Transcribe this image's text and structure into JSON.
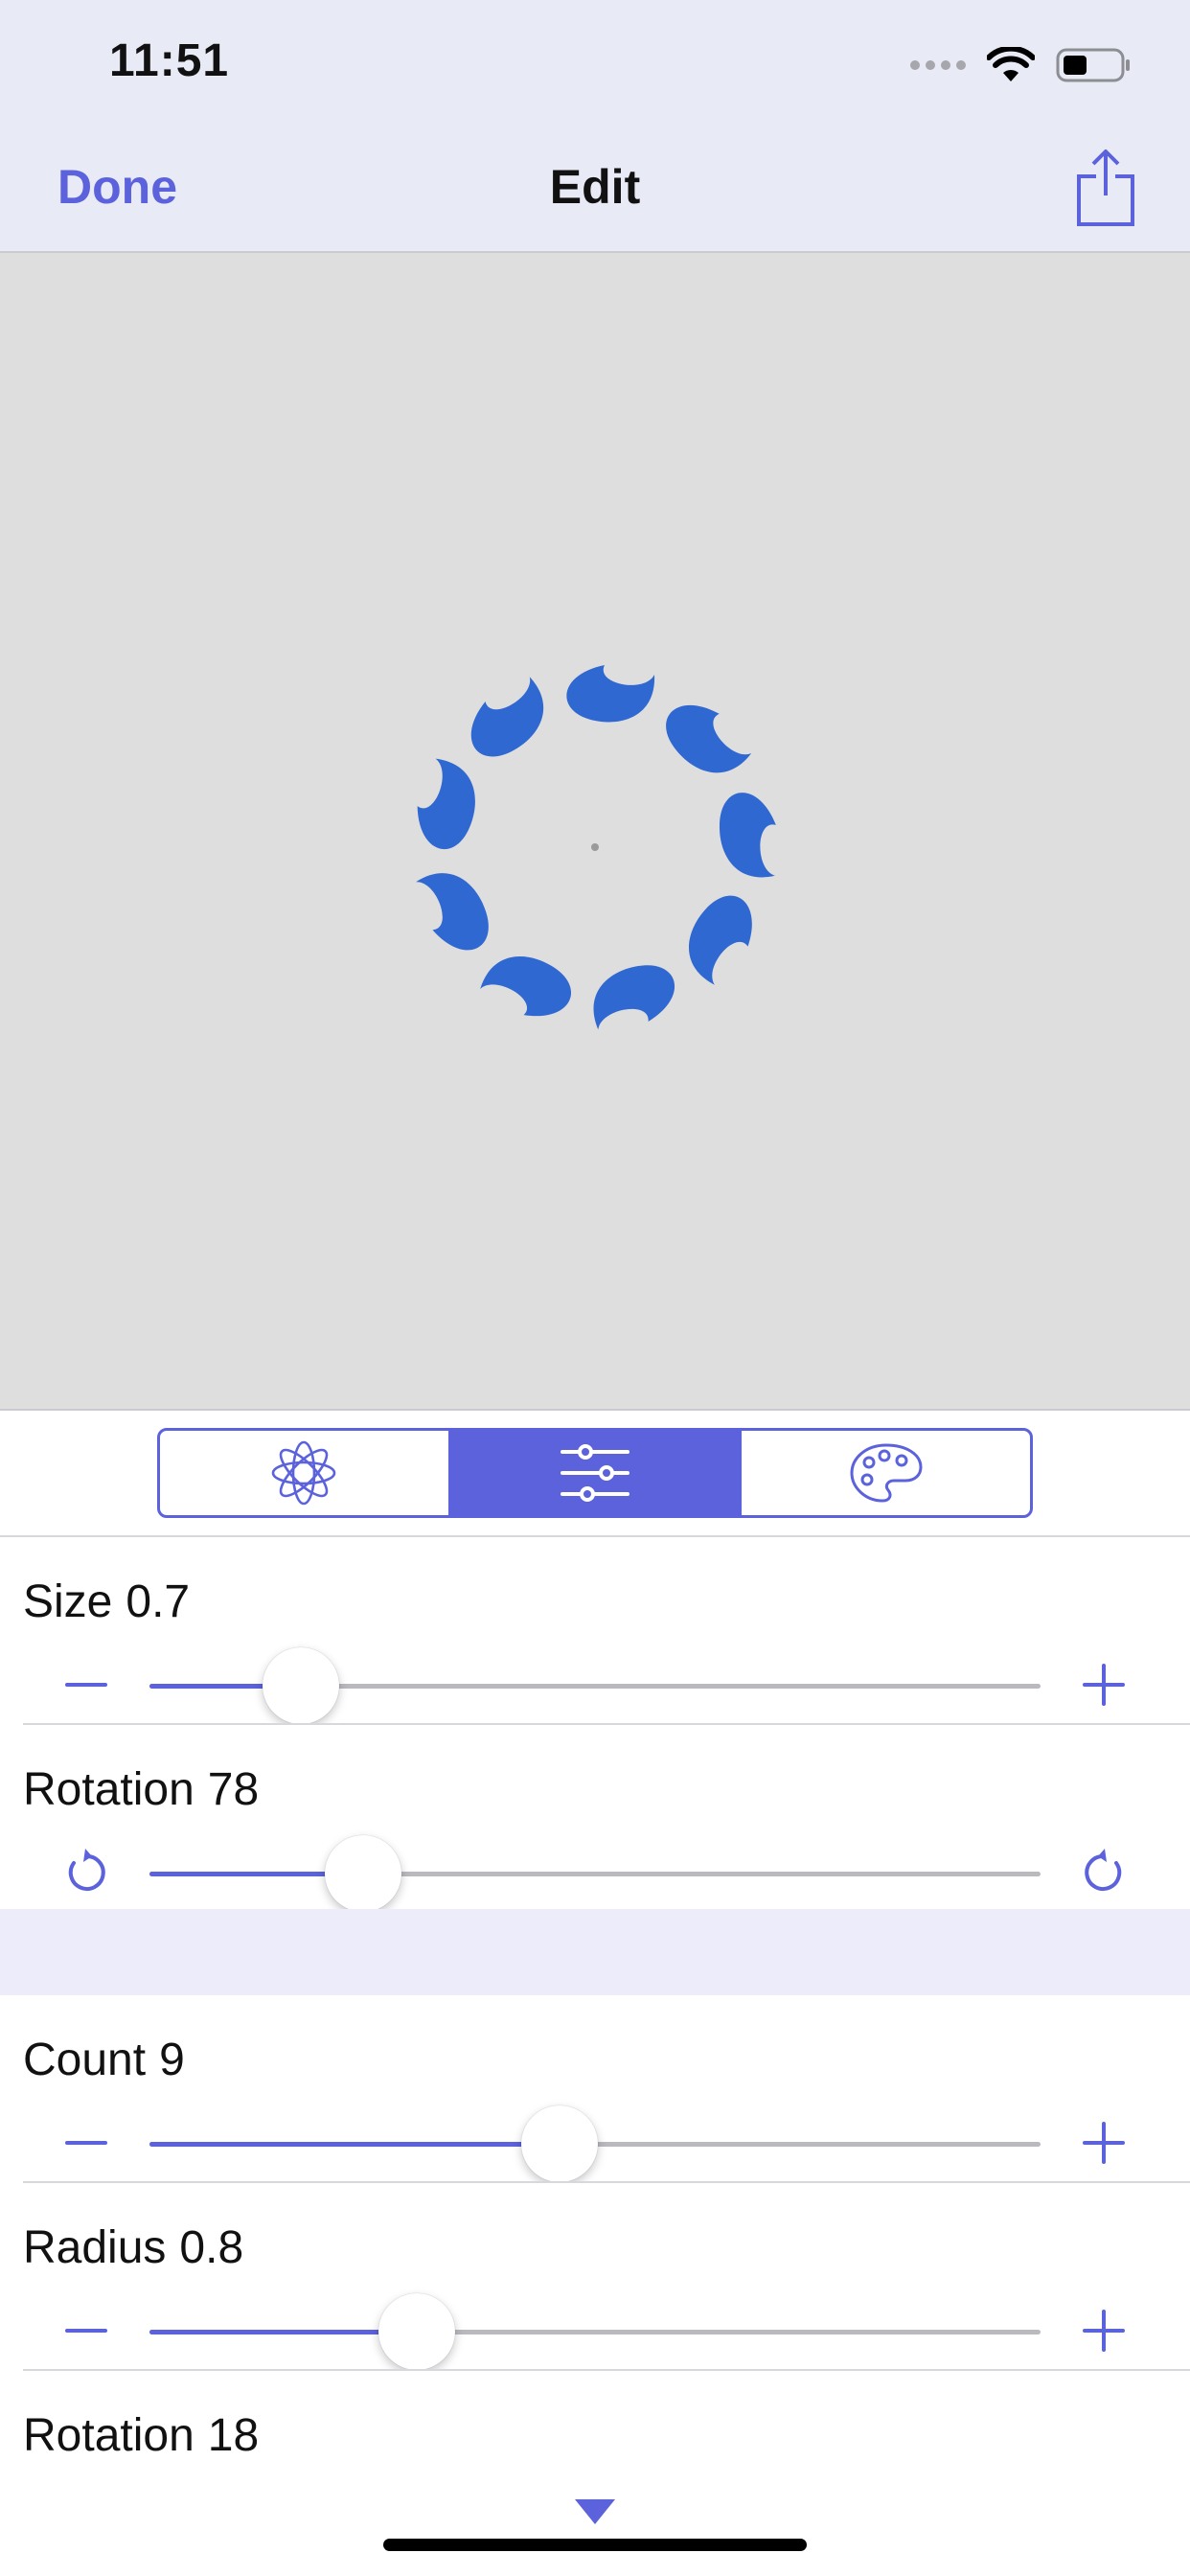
{
  "status_bar": {
    "time": "11:51"
  },
  "nav": {
    "done_label": "Done",
    "title": "Edit"
  },
  "canvas": {
    "background": "#dedede",
    "shape_color": "#2f68d0",
    "petal_count": 9
  },
  "segments": [
    {
      "icon": "flower-icon",
      "active": false
    },
    {
      "icon": "sliders-icon",
      "active": true
    },
    {
      "icon": "palette-icon",
      "active": false
    }
  ],
  "controls": [
    {
      "label": "Size",
      "value": "0.7",
      "left_icon": "minus-icon",
      "right_icon": "plus-icon",
      "level": 0.17
    },
    {
      "label": "Rotation",
      "value": "78",
      "left_icon": "rotate-ccw-icon",
      "right_icon": "rotate-cw-icon",
      "level": 0.24
    },
    {
      "label": "Count",
      "value": "9",
      "left_icon": "minus-icon",
      "right_icon": "plus-icon",
      "level": 0.46
    },
    {
      "label": "Radius",
      "value": "0.8",
      "left_icon": "minus-icon",
      "right_icon": "plus-icon",
      "level": 0.3
    },
    {
      "label": "Rotation",
      "value": "18"
    }
  ],
  "colors": {
    "accent": "#5b62dc",
    "nav_bg": "#e8eaf5",
    "section_band": "#ececfa"
  }
}
